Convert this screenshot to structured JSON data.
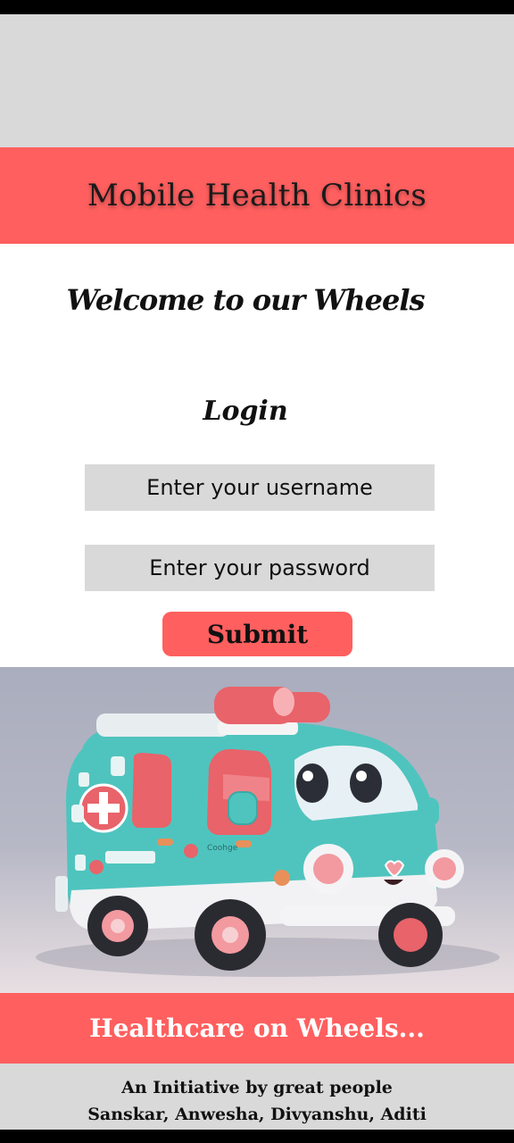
{
  "header": {
    "title": "Mobile Health Clinics"
  },
  "login": {
    "welcome": "Welcome to our Wheels",
    "title": "Login",
    "username_placeholder": "Enter your username",
    "password_placeholder": "Enter your password",
    "submit_label": "Submit"
  },
  "hero": {
    "image": "cartoon-ambulance-illustration",
    "van_text": "Coohge"
  },
  "banner": {
    "text": "Healthcare on Wheels..."
  },
  "footer": {
    "line1": "An Initiative by great people",
    "line2": "Sanskar, Anwesha, Divyanshu, Aditi"
  },
  "colors": {
    "accent": "#ff5f5f",
    "gray": "#d9d9d9",
    "van": "#4fc4be"
  }
}
